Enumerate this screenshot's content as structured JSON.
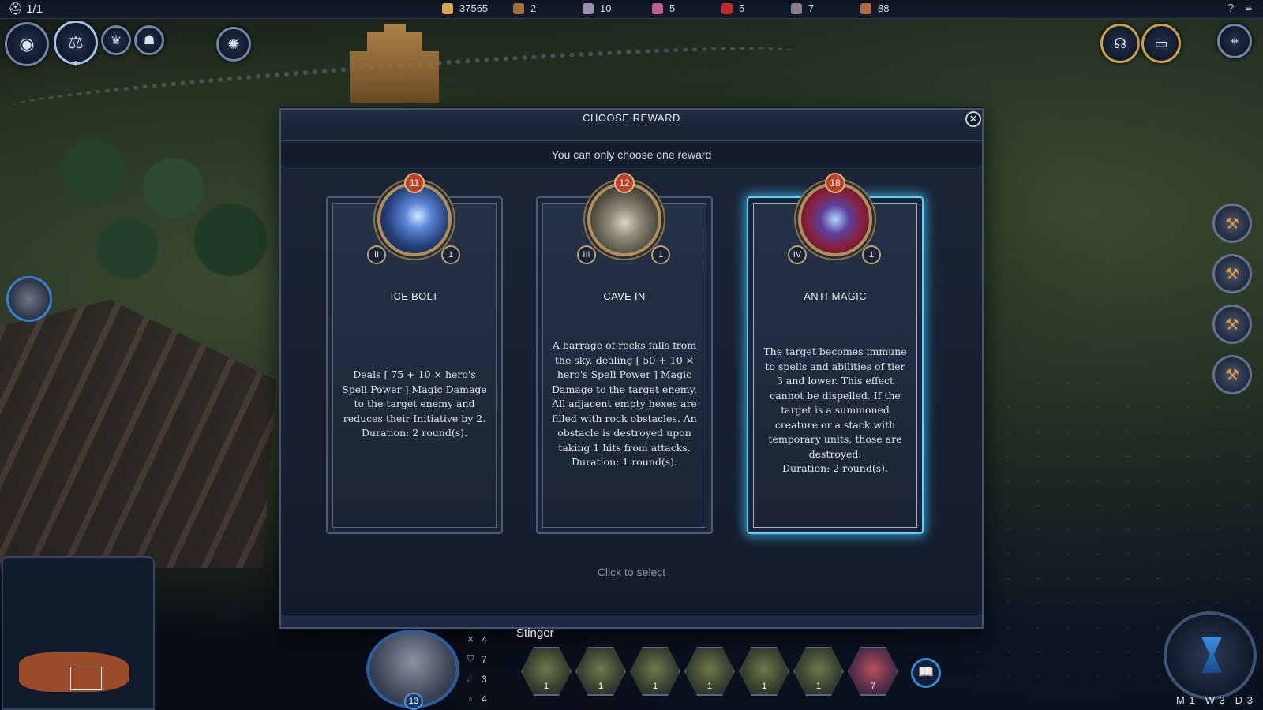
{
  "topbar": {
    "week_counter": "1/1",
    "resources": [
      {
        "name": "gold",
        "icon": "gold-coins-icon",
        "value": "37565",
        "color": "#d8a64a"
      },
      {
        "name": "wood",
        "icon": "wood-icon",
        "value": "2",
        "color": "#a0703c"
      },
      {
        "name": "ore",
        "icon": "ore-icon",
        "value": "10",
        "color": "#9a8fb0"
      },
      {
        "name": "gems",
        "icon": "gems-icon",
        "value": "5",
        "color": "#c06090"
      },
      {
        "name": "crystal",
        "icon": "crystal-icon",
        "value": "5",
        "color": "#c42a2a"
      },
      {
        "name": "mercury",
        "icon": "mercury-icon",
        "value": "7",
        "color": "#8a7f88"
      },
      {
        "name": "population",
        "icon": "population-icon",
        "value": "88",
        "color": "#b06a48"
      }
    ],
    "help": "?",
    "menu": "≡"
  },
  "modal": {
    "title": "CHOOSE REWARD",
    "subtitle": "You can only choose one reward",
    "footer": "Click to select",
    "close": "✕",
    "cards": [
      {
        "level": "11",
        "tier": "II",
        "cost": "1",
        "title": "ICE BOLT",
        "desc": "Deals [ 75 + 10 × hero's Spell Power ] Magic Damage to the target enemy and reduces their Initiative by 2.",
        "duration": "Duration: 2 round(s)."
      },
      {
        "level": "12",
        "tier": "III",
        "cost": "1",
        "title": "CAVE IN",
        "desc": "A barrage of rocks falls from the sky, dealing [ 50 + 10 × hero's Spell Power ] Magic Damage to the target enemy. All adjacent empty hexes are filled with rock obstacles. An obstacle is destroyed upon taking 1 hits from attacks.",
        "duration": "Duration: 1 round(s)."
      },
      {
        "level": "18",
        "tier": "IV",
        "cost": "1",
        "title": "ANTI-MAGIC",
        "desc": "The target becomes immune to spells and abilities of tier 3 and lower. This effect cannot be dispelled. If the target is a summoned creature or a stack with temporary units, those are destroyed.",
        "duration": "Duration: 2 round(s)."
      }
    ]
  },
  "hero": {
    "name": "Stinger",
    "level": "13",
    "stats": {
      "attack": "4",
      "defense": "7",
      "spell_power": "3",
      "knowledge": "4"
    },
    "badge_top": "4"
  },
  "army": [
    {
      "count": "1"
    },
    {
      "count": "1"
    },
    {
      "count": "1"
    },
    {
      "count": "1"
    },
    {
      "count": "1"
    },
    {
      "count": "1"
    },
    {
      "count": "7"
    }
  ],
  "date": {
    "month": "M 1",
    "week": "W 3",
    "day": "D 3"
  },
  "colors": {
    "selected_glow": "#5fd3ff",
    "level_badge": "#b8432d"
  }
}
